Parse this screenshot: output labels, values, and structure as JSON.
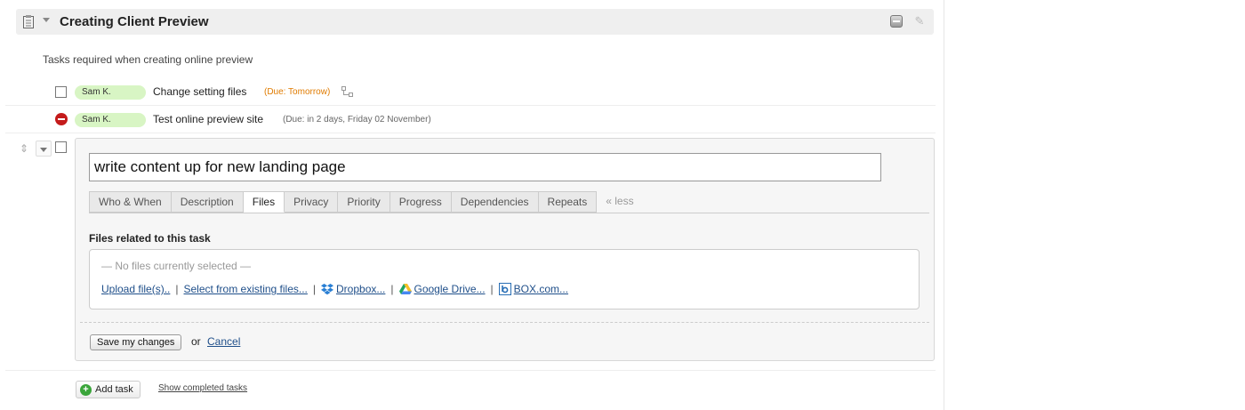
{
  "list": {
    "title": "Creating Client Preview",
    "description": "Tasks required when creating online preview"
  },
  "tasks": [
    {
      "assignee": "Sam K.",
      "name": "Change setting files",
      "due": "(Due: Tomorrow)",
      "status": "open"
    },
    {
      "assignee": "Sam K.",
      "name": "Test online preview site",
      "due": "(Due: in 2 days, Friday 02 November)",
      "status": "blocked"
    }
  ],
  "editor": {
    "task_title": "write content up for new landing page",
    "tabs": [
      "Who & When",
      "Description",
      "Files",
      "Privacy",
      "Priority",
      "Progress",
      "Dependencies",
      "Repeats"
    ],
    "active_tab": "Files",
    "less_label": "« less",
    "files_heading": "Files related to this task",
    "no_files": "— No files currently selected —",
    "file_links": {
      "upload": "Upload file(s)..",
      "existing": "Select from existing files...",
      "dropbox": "Dropbox...",
      "google_drive": "Google Drive...",
      "box": "BOX.com..."
    },
    "separator": "|",
    "save_label": "Save my changes",
    "or_text": "or",
    "cancel_label": "Cancel"
  },
  "footer": {
    "add_task_label": "Add task",
    "show_completed_label": "Show completed tasks"
  },
  "colors": {
    "assignee_bg": "#d8f5c4",
    "due_soon": "#e07b00",
    "link": "#1f4f8a",
    "blocked": "#c41b1b"
  }
}
